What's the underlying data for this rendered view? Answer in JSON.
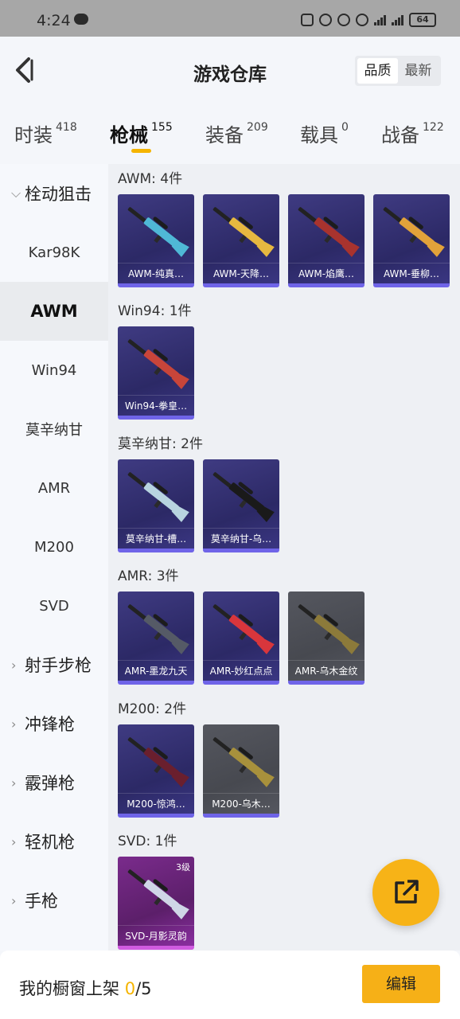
{
  "status_bar": {
    "time": "4:24",
    "battery": "64"
  },
  "header": {
    "title": "游戏仓库",
    "sort_options": [
      "品质",
      "最新"
    ],
    "sort_selected": "品质"
  },
  "tabs": [
    {
      "label": "时装",
      "count": "418"
    },
    {
      "label": "枪械",
      "count": "155"
    },
    {
      "label": "装备",
      "count": "209"
    },
    {
      "label": "载具",
      "count": "0"
    },
    {
      "label": "战备",
      "count": "122"
    }
  ],
  "sidebar": {
    "group_open": "栓动狙击",
    "sub_items": [
      "Kar98K",
      "AWM",
      "Win94",
      "莫辛纳甘",
      "AMR",
      "M200",
      "SVD"
    ],
    "active": "AWM",
    "groups": [
      "射手步枪",
      "冲锋枪",
      "霰弹枪",
      "轻机枪",
      "手枪"
    ]
  },
  "sections": [
    {
      "title": "AWM: 4件",
      "items": [
        {
          "label": "AWM-纯真…",
          "color": "#4fb8d6"
        },
        {
          "label": "AWM-天降…",
          "color": "#e6b840"
        },
        {
          "label": "AWM-焰鹰…",
          "color": "#a8332e"
        },
        {
          "label": "AWM-垂柳…",
          "color": "#e2a23a"
        }
      ]
    },
    {
      "title": "Win94: 1件",
      "items": [
        {
          "label": "Win94-拳皇…",
          "color": "#c8453a"
        }
      ]
    },
    {
      "title": "莫辛纳甘: 2件",
      "items": [
        {
          "label": "莫辛纳甘-槽…",
          "color": "#b8d4e0"
        },
        {
          "label": "莫辛纳甘-乌…",
          "color": "#1a1a1a"
        }
      ]
    },
    {
      "title": "AMR: 3件",
      "items": [
        {
          "label": "AMR-墨龙九天",
          "color": "#555a66"
        },
        {
          "label": "AMR-妙红点点",
          "color": "#d8363c"
        },
        {
          "label": "AMR-乌木金纹",
          "color": "#8c7a3a"
        }
      ]
    },
    {
      "title": "M200: 2件",
      "items": [
        {
          "label": "M200-惊鸿…",
          "color": "#6a1f2e"
        },
        {
          "label": "M200-乌木…",
          "color": "#a8913c"
        }
      ]
    },
    {
      "title": "SVD: 1件",
      "items": [
        {
          "label": "SVD-月影灵韵",
          "color": "#cfd6e6",
          "level": "3级"
        }
      ]
    }
  ],
  "bottom": {
    "label": "我的橱窗上架 ",
    "count": "0",
    "total": "/5",
    "edit_label": "编辑"
  },
  "fab": {
    "icon": "share-external-icon"
  }
}
